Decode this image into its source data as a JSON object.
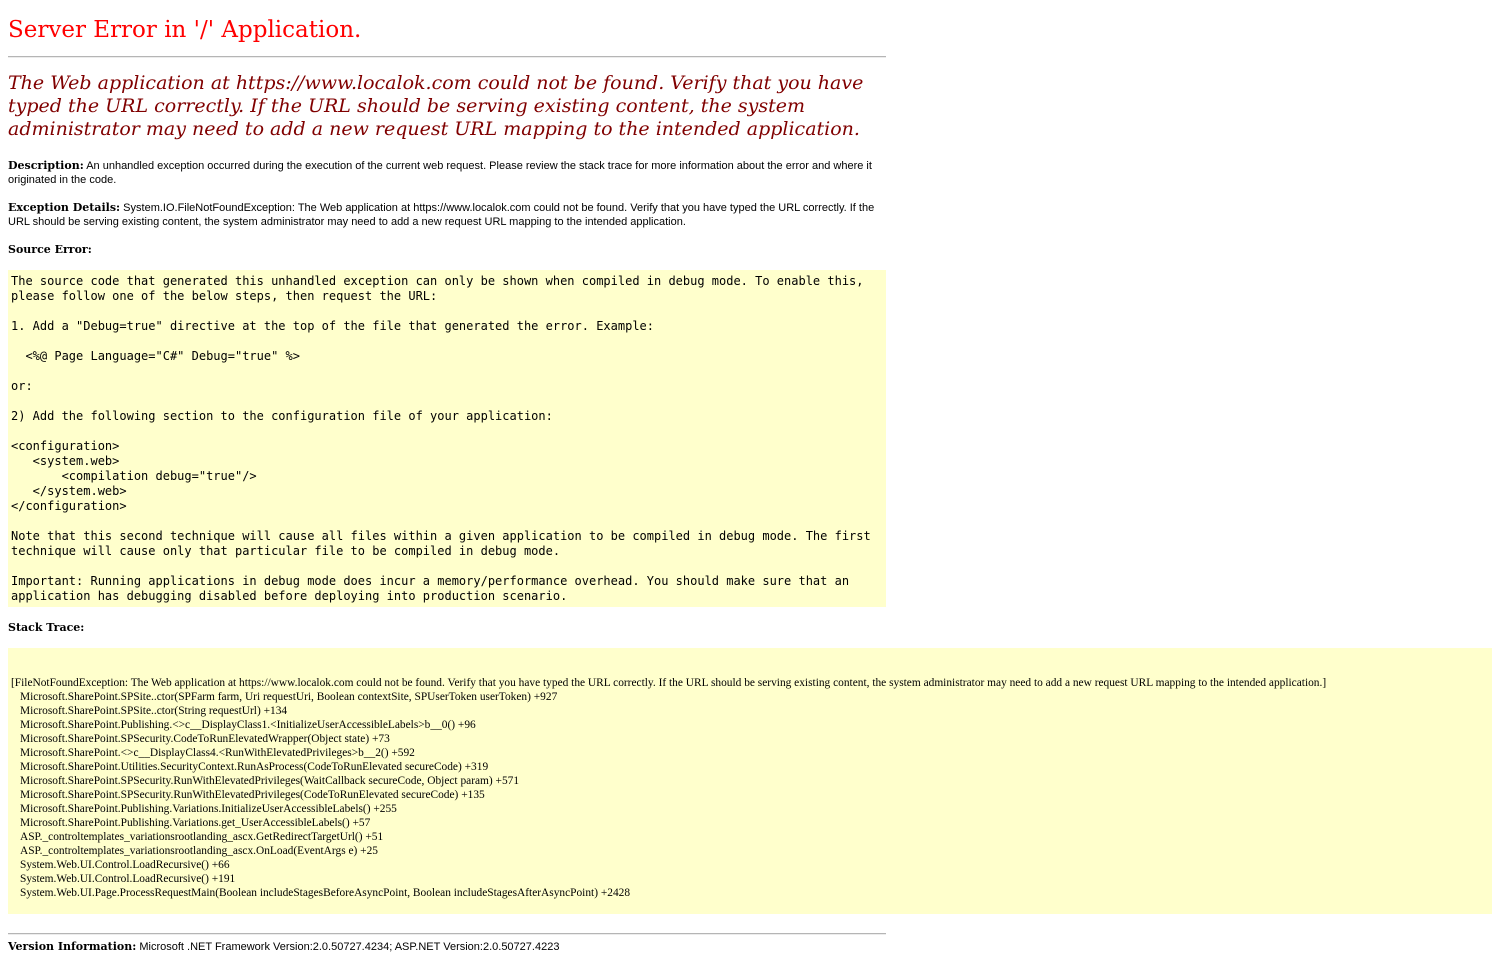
{
  "title": "Server Error in '/' Application.",
  "subtitle": "The Web application at https://www.localok.com could not be found. Verify that you have typed the URL correctly. If the URL should be serving existing content, the system administrator may need to add a new request URL mapping to the intended application.",
  "description": {
    "label": "Description:",
    "text": " An unhandled exception occurred during the execution of the current web request. Please review the stack trace for more information about the error and where it originated in the code."
  },
  "exception_details": {
    "label": "Exception Details:",
    "text": " System.IO.FileNotFoundException: The Web application at https://www.localok.com could not be found. Verify that you have typed the URL correctly. If the URL should be serving existing content, the system administrator may need to add a new request URL mapping to the intended application."
  },
  "source_error": {
    "heading": "Source Error:",
    "body": "The source code that generated this unhandled exception can only be shown when compiled in debug mode. To enable this,\nplease follow one of the below steps, then request the URL:\n\n1. Add a \"Debug=true\" directive at the top of the file that generated the error. Example:\n\n  <%@ Page Language=\"C#\" Debug=\"true\" %>\n\nor:\n\n2) Add the following section to the configuration file of your application:\n\n<configuration>\n   <system.web>\n       <compilation debug=\"true\"/>\n   </system.web>\n</configuration>\n\nNote that this second technique will cause all files within a given application to be compiled in debug mode. The first\ntechnique will cause only that particular file to be compiled in debug mode.\n\nImportant: Running applications in debug mode does incur a memory/performance overhead. You should make sure that an\napplication has debugging disabled before deploying into production scenario."
  },
  "stack_trace": {
    "heading": "Stack Trace:",
    "exception_line": "[FileNotFoundException: The Web application at https://www.localok.com could not be found. Verify that you have typed the URL correctly. If the URL should be serving existing content, the system administrator may need to add a new request URL mapping to the intended application.]",
    "frames": [
      "Microsoft.SharePoint.SPSite..ctor(SPFarm farm, Uri requestUri, Boolean contextSite, SPUserToken userToken) +927",
      "Microsoft.SharePoint.SPSite..ctor(String requestUrl) +134",
      "Microsoft.SharePoint.Publishing.<>c__DisplayClass1.<InitializeUserAccessibleLabels>b__0() +96",
      "Microsoft.SharePoint.SPSecurity.CodeToRunElevatedWrapper(Object state) +73",
      "Microsoft.SharePoint.<>c__DisplayClass4.<RunWithElevatedPrivileges>b__2() +592",
      "Microsoft.SharePoint.Utilities.SecurityContext.RunAsProcess(CodeToRunElevated secureCode) +319",
      "Microsoft.SharePoint.SPSecurity.RunWithElevatedPrivileges(WaitCallback secureCode, Object param) +571",
      "Microsoft.SharePoint.SPSecurity.RunWithElevatedPrivileges(CodeToRunElevated secureCode) +135",
      "Microsoft.SharePoint.Publishing.Variations.InitializeUserAccessibleLabels() +255",
      "Microsoft.SharePoint.Publishing.Variations.get_UserAccessibleLabels() +57",
      "ASP._controltemplates_variationsrootlanding_ascx.GetRedirectTargetUrl() +51",
      "ASP._controltemplates_variationsrootlanding_ascx.OnLoad(EventArgs e) +25",
      "System.Web.UI.Control.LoadRecursive() +66",
      "System.Web.UI.Control.LoadRecursive() +191",
      "System.Web.UI.Page.ProcessRequestMain(Boolean includeStagesBeforeAsyncPoint, Boolean includeStagesAfterAsyncPoint) +2428"
    ]
  },
  "version_info": {
    "label": "Version Information:",
    "text": " Microsoft .NET Framework Version:2.0.50727.4234; ASP.NET Version:2.0.50727.4223"
  }
}
